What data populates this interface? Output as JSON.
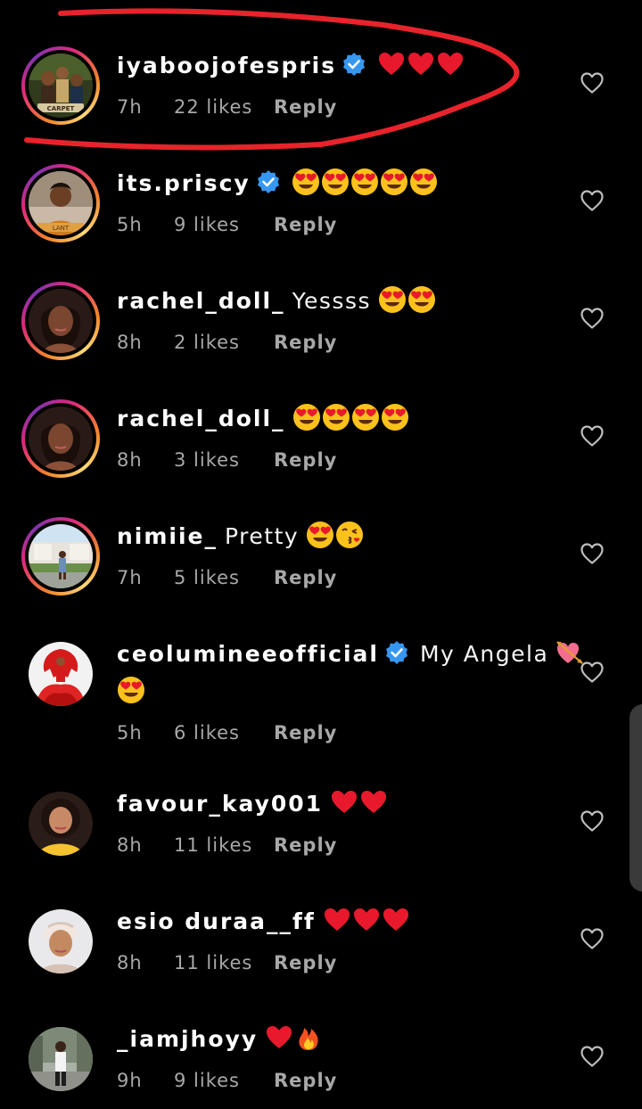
{
  "comments": [
    {
      "username": "iyaboojofespris",
      "verified": true,
      "text": "",
      "emojis": [
        "heart",
        "heart",
        "heart"
      ],
      "time": "7h",
      "likes": "22 likes",
      "reply": "Reply",
      "ring": true,
      "avatar": "movie-poster"
    },
    {
      "username": "its.priscy",
      "verified": true,
      "text": "",
      "emojis": [
        "heart-eyes",
        "heart-eyes",
        "heart-eyes",
        "heart-eyes",
        "heart-eyes"
      ],
      "time": "5h",
      "likes": "9 likes",
      "reply": "Reply",
      "ring": true,
      "avatar": "woman-orange"
    },
    {
      "username": "rachel_doll_",
      "verified": false,
      "text": "Yessss",
      "emojis": [
        "heart-eyes",
        "heart-eyes"
      ],
      "time": "8h",
      "likes": "2 likes",
      "reply": "Reply",
      "ring": true,
      "avatar": "woman-portrait"
    },
    {
      "username": "rachel_doll_",
      "verified": false,
      "text": "",
      "emojis": [
        "heart-eyes",
        "heart-eyes",
        "heart-eyes",
        "heart-eyes"
      ],
      "time": "8h",
      "likes": "3 likes",
      "reply": "Reply",
      "ring": true,
      "avatar": "woman-portrait"
    },
    {
      "username": "nimiie_",
      "verified": false,
      "text": "Pretty",
      "emojis": [
        "heart-eyes",
        "kiss"
      ],
      "time": "7h",
      "likes": "5 likes",
      "reply": "Reply",
      "ring": true,
      "avatar": "outdoor-person"
    },
    {
      "username": "ceolumineeofficial",
      "verified": true,
      "text": "My Angela",
      "emojis": [
        "heart-arrow"
      ],
      "emojis2": [
        "heart-eyes"
      ],
      "time": "5h",
      "likes": "6 likes",
      "reply": "Reply",
      "ring": false,
      "avatar": "red-dress"
    },
    {
      "username": "favour_kay001",
      "verified": false,
      "text": "",
      "emojis": [
        "heart",
        "heart"
      ],
      "time": "8h",
      "likes": "11 likes",
      "reply": "Reply",
      "ring": false,
      "avatar": "woman-yellow"
    },
    {
      "username": "esio duraa__ff",
      "verified": false,
      "text": "",
      "emojis": [
        "heart",
        "heart",
        "heart"
      ],
      "time": "8h",
      "likes": "11 likes",
      "reply": "Reply",
      "ring": false,
      "avatar": "woman-headwrap"
    },
    {
      "username": "_iamjhoyy",
      "verified": false,
      "text": "",
      "emojis": [
        "heart",
        "fire"
      ],
      "time": "9h",
      "likes": "9 likes",
      "reply": "Reply",
      "ring": false,
      "avatar": "street-person"
    }
  ],
  "colors": {
    "background": "#000000",
    "username": "#ffffff",
    "meta": "#a8a8a8",
    "verified": "#3797f0",
    "highlight": "#e8232b"
  },
  "icons": {
    "like": "heart-outline-icon",
    "verified": "verified-badge-icon"
  }
}
